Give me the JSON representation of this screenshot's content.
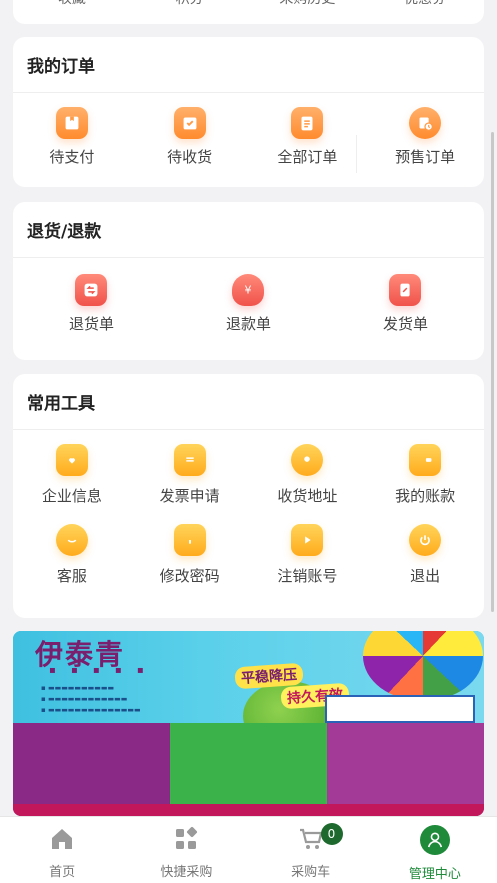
{
  "top_row": [
    "收藏",
    "积分",
    "采购历史",
    "优惠券"
  ],
  "orders": {
    "title": "我的订单",
    "items": [
      {
        "label": "待支付",
        "icon": "wallet-icon"
      },
      {
        "label": "待收货",
        "icon": "inbox-check-icon"
      },
      {
        "label": "全部订单",
        "icon": "clipboard-list-icon"
      },
      {
        "label": "预售订单",
        "icon": "clock-document-icon"
      }
    ]
  },
  "refund": {
    "title": "退货/退款",
    "items": [
      {
        "label": "退货单",
        "icon": "return-icon"
      },
      {
        "label": "退款单",
        "icon": "money-bag-icon"
      },
      {
        "label": "发货单",
        "icon": "shipping-document-icon"
      }
    ]
  },
  "tools": {
    "title": "常用工具",
    "items": [
      {
        "label": "企业信息",
        "icon": "store-heart-icon"
      },
      {
        "label": "发票申请",
        "icon": "receipt-icon"
      },
      {
        "label": "收货地址",
        "icon": "location-pin-icon"
      },
      {
        "label": "我的账款",
        "icon": "wallet-icon"
      },
      {
        "label": "客服",
        "icon": "chat-smile-icon"
      },
      {
        "label": "修改密码",
        "icon": "lock-icon"
      },
      {
        "label": "注销账号",
        "icon": "play-icon"
      },
      {
        "label": "退出",
        "icon": "power-icon"
      }
    ]
  },
  "banner": {
    "title": "伊泰青",
    "slogan_line1": "平稳降压",
    "slogan_line2": "持久有效"
  },
  "tabbar": {
    "items": [
      {
        "label": "首页",
        "icon": "home-icon"
      },
      {
        "label": "快捷采购",
        "icon": "grid-icon"
      },
      {
        "label": "采购车",
        "icon": "cart-icon",
        "badge": "0"
      },
      {
        "label": "管理中心",
        "icon": "user-icon",
        "active": true
      }
    ]
  },
  "colors": {
    "accent_orange": "#ff8b2e",
    "accent_green": "#1e8a3a",
    "accent_red": "#f0524a"
  }
}
